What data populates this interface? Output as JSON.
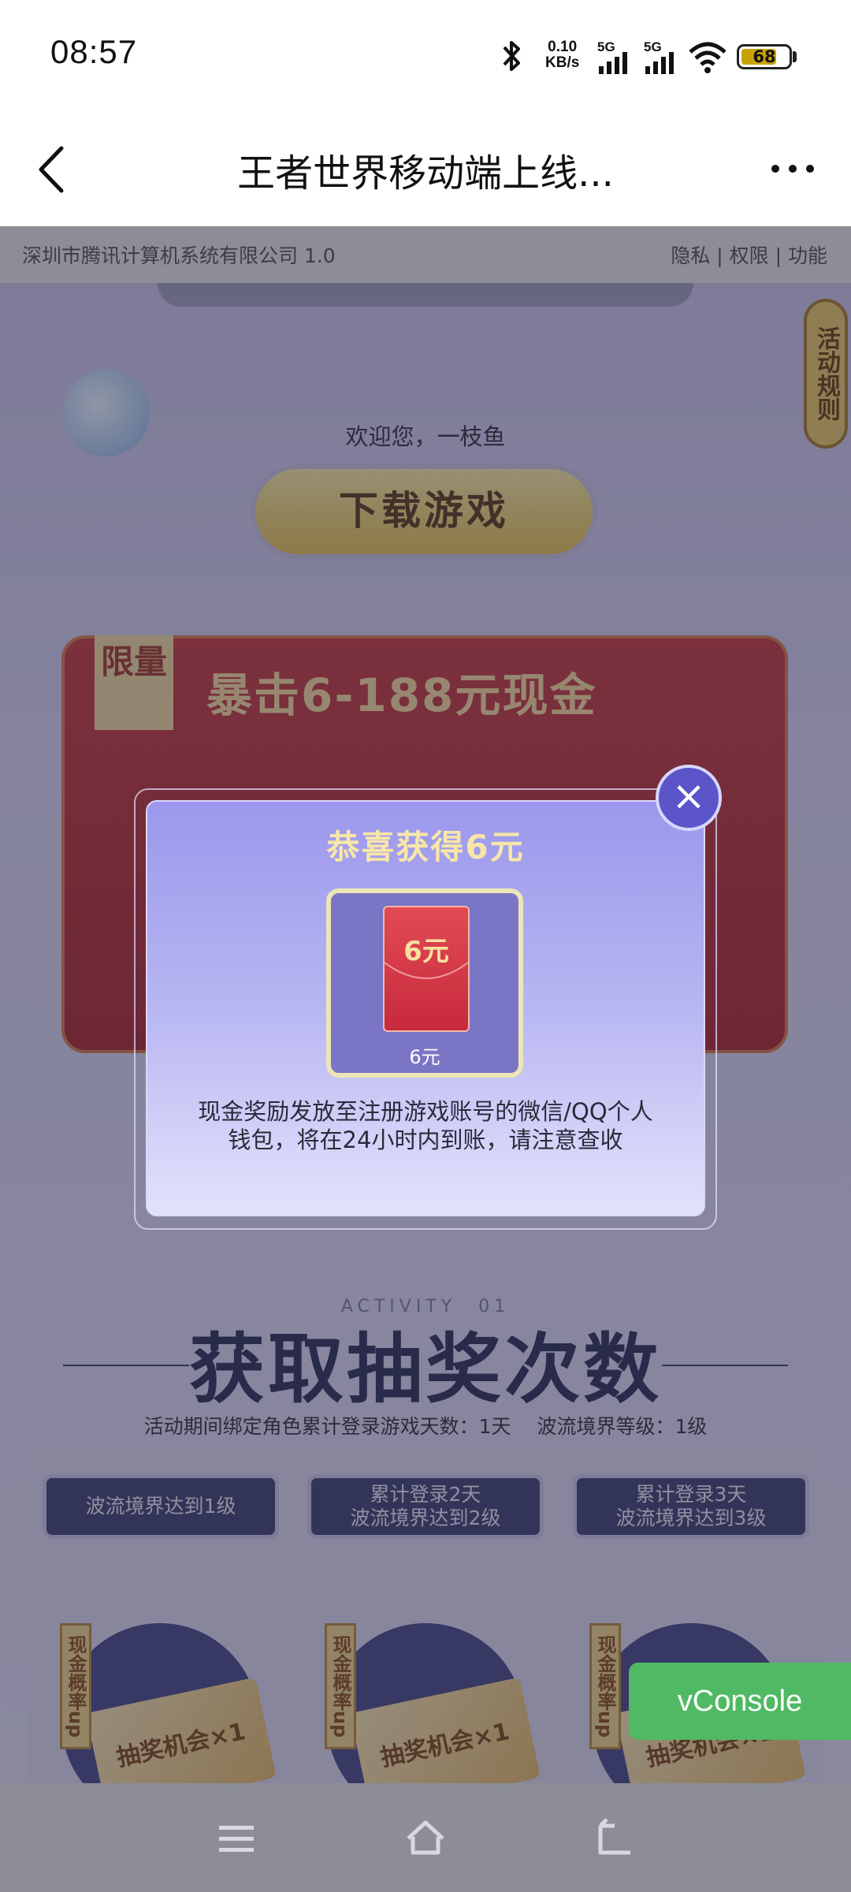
{
  "status_bar": {
    "time": "08:57",
    "net_rate_value": "0.10",
    "net_rate_unit": "KB/s",
    "sim1": "5G",
    "sim2": "5G",
    "battery": "68"
  },
  "header": {
    "title": "王者世界移动端上线...",
    "back_icon": "chevron-left-icon",
    "more_icon": "more-horizontal-icon"
  },
  "company_bar": {
    "company": "深圳市腾讯计算机系统有限公司 1.0",
    "legal_links": "隐私 | 权限 | 功能"
  },
  "page": {
    "rules_tab": "活动规则",
    "welcome": "欢迎您，一枝鱼",
    "download_button": "下载游戏",
    "limited_tag": "限量",
    "envelope_title": "暴击6-188元现金",
    "activity_en": "ACTIVITY　01",
    "activity_title": "获取抽奖次数",
    "login_info": "活动期间绑定角色累计登录游戏天数：1天　 波流境界等级：1级",
    "tasks": [
      {
        "line1": "波流境界达到1级",
        "line2": ""
      },
      {
        "line1": "累计登录2天",
        "line2": "波流境界达到2级"
      },
      {
        "line1": "累计登录3天",
        "line2": "波流境界达到3级"
      }
    ],
    "probability_label": "现金概率up",
    "ticket_label": "抽奖机会×1"
  },
  "modal": {
    "title": "恭喜获得6元",
    "prize_amount": "6元",
    "prize_name": "6元",
    "description": "现金奖励发放至注册游戏账号的微信/QQ个人钱包，将在24小时内到账，请注意查收",
    "close_icon": "close-icon"
  },
  "vconsole": {
    "label": "vConsole"
  },
  "colors": {
    "accent_green": "#50b963",
    "modal_purple": "#9b97ec",
    "redpacket": "#d23a48"
  }
}
